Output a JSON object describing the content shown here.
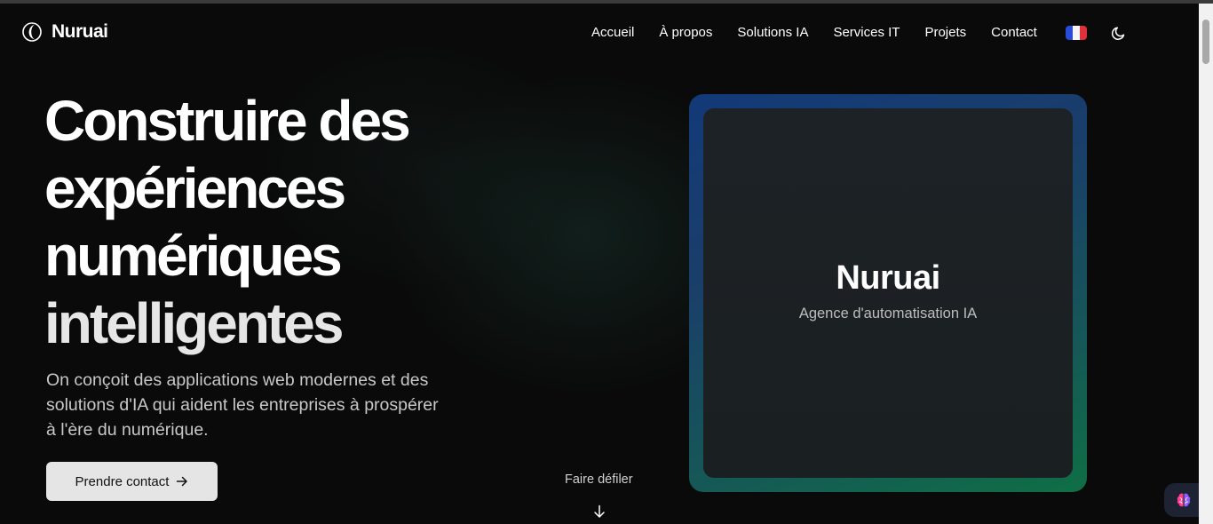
{
  "brand": {
    "name": "Nuruai"
  },
  "nav": {
    "items": [
      {
        "label": "Accueil"
      },
      {
        "label": "À propos"
      },
      {
        "label": "Solutions IA"
      },
      {
        "label": "Services IT"
      },
      {
        "label": "Projets"
      },
      {
        "label": "Contact"
      }
    ],
    "language_icon": "french-flag-icon",
    "theme_icon": "moon-icon"
  },
  "hero": {
    "title_lines": [
      "Construire des",
      "expériences",
      "numériques",
      "intelligentes"
    ],
    "subtitle": "On conçoit des applications web modernes et des solutions d'IA qui aident les entreprises à prospérer à l'ère du numérique.",
    "cta_label": "Prendre contact",
    "cta_icon": "arrow-right-icon",
    "scroll_label": "Faire défiler",
    "scroll_icon": "arrow-down-icon"
  },
  "card": {
    "title": "Nuruai",
    "subtitle": "Agence d'automatisation IA"
  },
  "chat_widget": {
    "icon": "brain-icon"
  },
  "colors": {
    "background": "#0a0a0a",
    "card_gradient_start": "#123a78",
    "card_gradient_end": "#0f6f45",
    "cta_background": "#e5e5e5"
  }
}
